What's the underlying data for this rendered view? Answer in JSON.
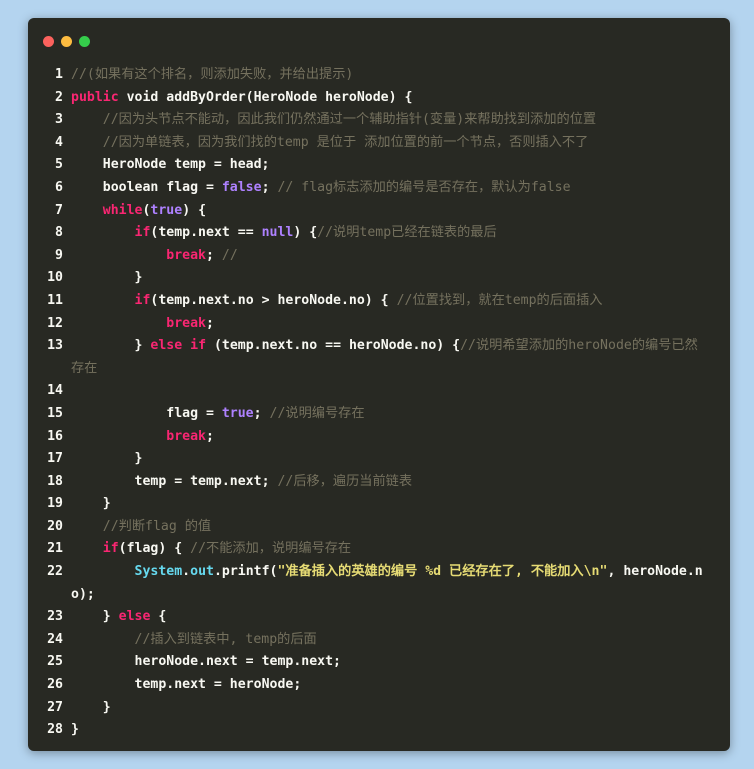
{
  "window": {
    "controls": [
      "close",
      "minimize",
      "maximize"
    ]
  },
  "colors": {
    "background": "#282923",
    "comment": "#75715e",
    "keyword": "#f92672",
    "literal": "#ae81ff",
    "string": "#e6db74",
    "builtin": "#66d9ef",
    "plain": "#f8f8f2"
  },
  "code": {
    "language": "java",
    "lines": [
      {
        "n": "1",
        "tokens": [
          {
            "t": "comment",
            "v": "//(如果有这个排名，则添加失败，并给出提示)"
          }
        ]
      },
      {
        "n": "2",
        "tokens": [
          {
            "t": "keyword",
            "v": "public"
          },
          {
            "t": "plain",
            "v": " void addByOrder(HeroNode heroNode) {"
          }
        ]
      },
      {
        "n": "3",
        "tokens": [
          {
            "t": "plain",
            "v": "    "
          },
          {
            "t": "comment",
            "v": "//因为头节点不能动，因此我们仍然通过一个辅助指针(变量)来帮助找到添加的位置"
          }
        ]
      },
      {
        "n": "4",
        "tokens": [
          {
            "t": "plain",
            "v": "    "
          },
          {
            "t": "comment",
            "v": "//因为单链表，因为我们找的temp 是位于 添加位置的前一个节点，否则插入不了"
          }
        ]
      },
      {
        "n": "5",
        "tokens": [
          {
            "t": "plain",
            "v": "    HeroNode temp = head;"
          }
        ]
      },
      {
        "n": "6",
        "tokens": [
          {
            "t": "plain",
            "v": "    boolean flag = "
          },
          {
            "t": "literal",
            "v": "false"
          },
          {
            "t": "plain",
            "v": "; "
          },
          {
            "t": "comment",
            "v": "// flag标志添加的编号是否存在，默认为false"
          }
        ]
      },
      {
        "n": "7",
        "tokens": [
          {
            "t": "plain",
            "v": "    "
          },
          {
            "t": "keyword",
            "v": "while"
          },
          {
            "t": "plain",
            "v": "("
          },
          {
            "t": "literal",
            "v": "true"
          },
          {
            "t": "plain",
            "v": ") {"
          }
        ]
      },
      {
        "n": "8",
        "tokens": [
          {
            "t": "plain",
            "v": "        "
          },
          {
            "t": "keyword",
            "v": "if"
          },
          {
            "t": "plain",
            "v": "(temp.next == "
          },
          {
            "t": "literal",
            "v": "null"
          },
          {
            "t": "plain",
            "v": ") {"
          },
          {
            "t": "comment",
            "v": "//说明temp已经在链表的最后"
          }
        ]
      },
      {
        "n": "9",
        "tokens": [
          {
            "t": "plain",
            "v": "            "
          },
          {
            "t": "keyword",
            "v": "break"
          },
          {
            "t": "plain",
            "v": "; "
          },
          {
            "t": "comment",
            "v": "//"
          }
        ]
      },
      {
        "n": "10",
        "tokens": [
          {
            "t": "plain",
            "v": "        }"
          }
        ]
      },
      {
        "n": "11",
        "tokens": [
          {
            "t": "plain",
            "v": "        "
          },
          {
            "t": "keyword",
            "v": "if"
          },
          {
            "t": "plain",
            "v": "(temp.next.no > heroNode.no) { "
          },
          {
            "t": "comment",
            "v": "//位置找到，就在temp的后面插入"
          }
        ]
      },
      {
        "n": "12",
        "tokens": [
          {
            "t": "plain",
            "v": "            "
          },
          {
            "t": "keyword",
            "v": "break"
          },
          {
            "t": "plain",
            "v": ";"
          }
        ]
      },
      {
        "n": "13",
        "tokens": [
          {
            "t": "plain",
            "v": "        } "
          },
          {
            "t": "keyword",
            "v": "else"
          },
          {
            "t": "plain",
            "v": " "
          },
          {
            "t": "keyword",
            "v": "if"
          },
          {
            "t": "plain",
            "v": " (temp.next.no == heroNode.no) {"
          },
          {
            "t": "comment",
            "v": "//说明希望添加的heroNode的编号已然存在"
          }
        ]
      },
      {
        "n": "14",
        "tokens": [
          {
            "t": "plain",
            "v": ""
          }
        ]
      },
      {
        "n": "15",
        "tokens": [
          {
            "t": "plain",
            "v": "            flag = "
          },
          {
            "t": "literal",
            "v": "true"
          },
          {
            "t": "plain",
            "v": "; "
          },
          {
            "t": "comment",
            "v": "//说明编号存在"
          }
        ]
      },
      {
        "n": "16",
        "tokens": [
          {
            "t": "plain",
            "v": "            "
          },
          {
            "t": "keyword",
            "v": "break"
          },
          {
            "t": "plain",
            "v": ";"
          }
        ]
      },
      {
        "n": "17",
        "tokens": [
          {
            "t": "plain",
            "v": "        }"
          }
        ]
      },
      {
        "n": "18",
        "tokens": [
          {
            "t": "plain",
            "v": "        temp = temp.next; "
          },
          {
            "t": "comment",
            "v": "//后移，遍历当前链表"
          }
        ]
      },
      {
        "n": "19",
        "tokens": [
          {
            "t": "plain",
            "v": "    }"
          }
        ]
      },
      {
        "n": "20",
        "tokens": [
          {
            "t": "plain",
            "v": "    "
          },
          {
            "t": "comment",
            "v": "//判断flag 的值"
          }
        ]
      },
      {
        "n": "21",
        "tokens": [
          {
            "t": "plain",
            "v": "    "
          },
          {
            "t": "keyword",
            "v": "if"
          },
          {
            "t": "plain",
            "v": "(flag) { "
          },
          {
            "t": "comment",
            "v": "//不能添加，说明编号存在"
          }
        ]
      },
      {
        "n": "22",
        "tokens": [
          {
            "t": "plain",
            "v": "        "
          },
          {
            "t": "builtin",
            "v": "System"
          },
          {
            "t": "plain",
            "v": "."
          },
          {
            "t": "builtin",
            "v": "out"
          },
          {
            "t": "plain",
            "v": ".printf("
          },
          {
            "t": "string",
            "v": "\"准备插入的英雄的编号 %d 已经存在了, 不能加入\\n\""
          },
          {
            "t": "plain",
            "v": ", heroNode.no);"
          }
        ]
      },
      {
        "n": "23",
        "tokens": [
          {
            "t": "plain",
            "v": "    } "
          },
          {
            "t": "keyword",
            "v": "else"
          },
          {
            "t": "plain",
            "v": " {"
          }
        ]
      },
      {
        "n": "24",
        "tokens": [
          {
            "t": "plain",
            "v": "        "
          },
          {
            "t": "comment",
            "v": "//插入到链表中, temp的后面"
          }
        ]
      },
      {
        "n": "25",
        "tokens": [
          {
            "t": "plain",
            "v": "        heroNode.next = temp.next;"
          }
        ]
      },
      {
        "n": "26",
        "tokens": [
          {
            "t": "plain",
            "v": "        temp.next = heroNode;"
          }
        ]
      },
      {
        "n": "27",
        "tokens": [
          {
            "t": "plain",
            "v": "    }"
          }
        ]
      },
      {
        "n": "28",
        "tokens": [
          {
            "t": "plain",
            "v": "}"
          }
        ]
      }
    ]
  }
}
